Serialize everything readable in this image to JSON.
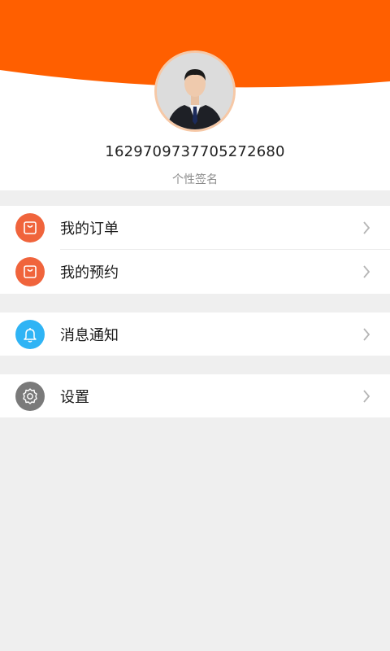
{
  "profile": {
    "user_id": "1629709737705272680",
    "signature": "个性签名",
    "avatar_icon": "user-avatar-photo",
    "banner_color": "#ff5f00"
  },
  "menu": {
    "groups": [
      {
        "items": [
          {
            "label": "我的订单",
            "icon": "shopping-bag-icon",
            "icon_color": "#f0643c"
          },
          {
            "label": "我的预约",
            "icon": "shopping-bag-icon",
            "icon_color": "#f0643c"
          }
        ]
      },
      {
        "items": [
          {
            "label": "消息通知",
            "icon": "bell-icon",
            "icon_color": "#2fb4f5"
          }
        ]
      },
      {
        "items": [
          {
            "label": "设置",
            "icon": "gear-icon",
            "icon_color": "#7a7a7a"
          }
        ]
      }
    ]
  },
  "colors": {
    "background": "#efefef",
    "chevron": "#b5b5b5"
  }
}
